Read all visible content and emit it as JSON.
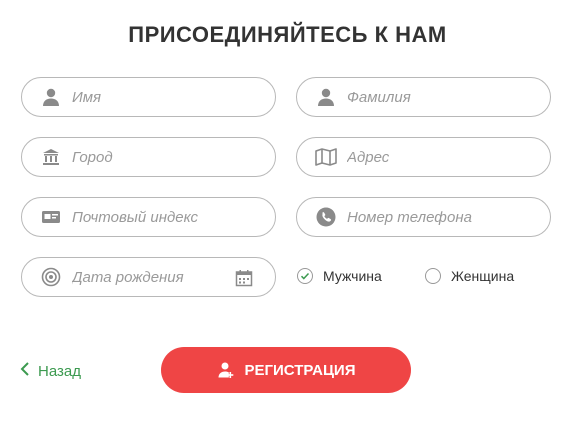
{
  "form": {
    "title": "ПРИСОЕДИНЯЙТЕСЬ К НАМ",
    "fields": {
      "first_name": {
        "placeholder": "Имя",
        "icon": "user-icon"
      },
      "last_name": {
        "placeholder": "Фамилия",
        "icon": "user-icon"
      },
      "city": {
        "placeholder": "Город",
        "icon": "bank-icon"
      },
      "address": {
        "placeholder": "Адрес",
        "icon": "map-icon"
      },
      "zip": {
        "placeholder": "Почтовый индекс",
        "icon": "card-icon"
      },
      "phone": {
        "placeholder": "Номер телефона",
        "icon": "phone-icon"
      },
      "birth_date": {
        "placeholder": "Дата рождения",
        "icon": "target-icon",
        "trailing_icon": "calendar-icon"
      }
    },
    "gender": {
      "male_label": "Мужчина",
      "female_label": "Женщина",
      "selected": "male"
    },
    "back_label": "Назад",
    "submit_label": "РЕГИСТРАЦИЯ"
  },
  "colors": {
    "accent": "#ef4545",
    "back": "#3c9a50",
    "check": "#3c9a50",
    "border": "#b8b8b8",
    "icon": "#8a8a8a"
  }
}
